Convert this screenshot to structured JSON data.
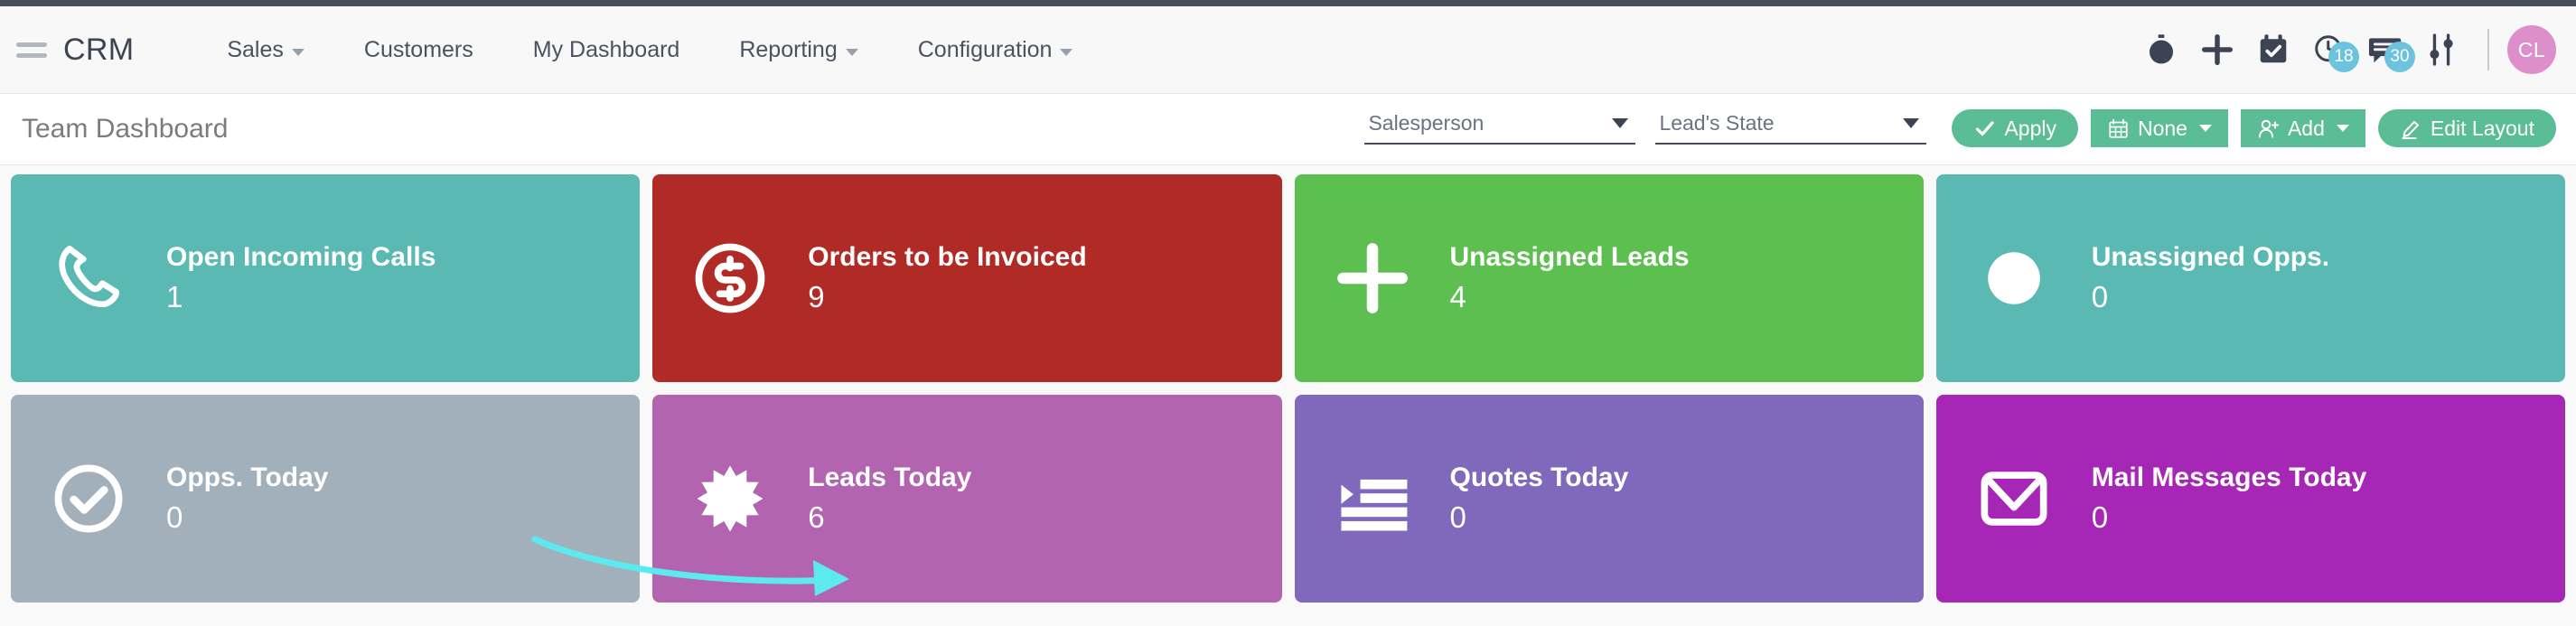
{
  "navbar": {
    "brand": "CRM",
    "menu": [
      {
        "label": "Sales",
        "caret": true
      },
      {
        "label": "Customers",
        "caret": false
      },
      {
        "label": "My Dashboard",
        "caret": false
      },
      {
        "label": "Reporting",
        "caret": true
      },
      {
        "label": "Configuration",
        "caret": true
      }
    ],
    "icons": [
      {
        "name": "stopwatch-icon",
        "badge": ""
      },
      {
        "name": "plus-icon",
        "badge": ""
      },
      {
        "name": "calendar-check-icon",
        "badge": ""
      },
      {
        "name": "clock-activities-icon",
        "badge": "18"
      },
      {
        "name": "messages-icon",
        "badge": "30"
      },
      {
        "name": "sliders-icon",
        "badge": ""
      }
    ],
    "avatar": "CL",
    "avatar_color": "#dd8fcc",
    "badge_color": "#6cc3e0"
  },
  "control_panel": {
    "title": "Team Dashboard",
    "filters": [
      {
        "name": "salesperson",
        "value": "Salesperson"
      },
      {
        "name": "leads-state",
        "value": "Lead's State"
      }
    ],
    "buttons": [
      {
        "name": "apply-button",
        "label": "Apply",
        "icon": "check-icon",
        "caret": false,
        "round": true
      },
      {
        "name": "period-button",
        "label": "None",
        "icon": "calendar-icon",
        "caret": true,
        "round": false
      },
      {
        "name": "add-button",
        "label": "Add",
        "icon": "user-add-icon",
        "caret": true,
        "round": false
      },
      {
        "name": "edit-layout-button",
        "label": "Edit Layout",
        "icon": "pencil-icon",
        "caret": false,
        "round": true
      }
    ],
    "button_color": "#5bbd95"
  },
  "dashboard": {
    "cards": [
      {
        "name": "open-incoming-calls",
        "title": "Open Incoming Calls",
        "value": "1",
        "color": "#5ab9b3",
        "icon": "phone-icon"
      },
      {
        "name": "orders-to-be-invoiced",
        "title": "Orders to be Invoiced",
        "value": "9",
        "color": "#b02b25",
        "icon": "dollar-circle-icon"
      },
      {
        "name": "unassigned-leads",
        "title": "Unassigned Leads",
        "value": "4",
        "color": "#5cbf4f",
        "icon": "plus-icon"
      },
      {
        "name": "unassigned-opps",
        "title": "Unassigned Opps.",
        "value": "0",
        "color": "#5ab9b3",
        "icon": "circle-icon"
      },
      {
        "name": "opps-today",
        "title": "Opps. Today",
        "value": "0",
        "color": "#a2b0bb",
        "icon": "check-circle-icon"
      },
      {
        "name": "leads-today",
        "title": "Leads Today",
        "value": "6",
        "color": "#b364b0",
        "icon": "starburst-icon"
      },
      {
        "name": "quotes-today",
        "title": "Quotes Today",
        "value": "0",
        "color": "#8069bd",
        "icon": "list-indent-icon"
      },
      {
        "name": "mail-messages-today",
        "title": "Mail Messages Today",
        "value": "0",
        "color": "#a626b5",
        "icon": "envelope-icon"
      }
    ]
  },
  "annotation": {
    "name": "pointer-arrow",
    "color": "#5ceaf0"
  }
}
